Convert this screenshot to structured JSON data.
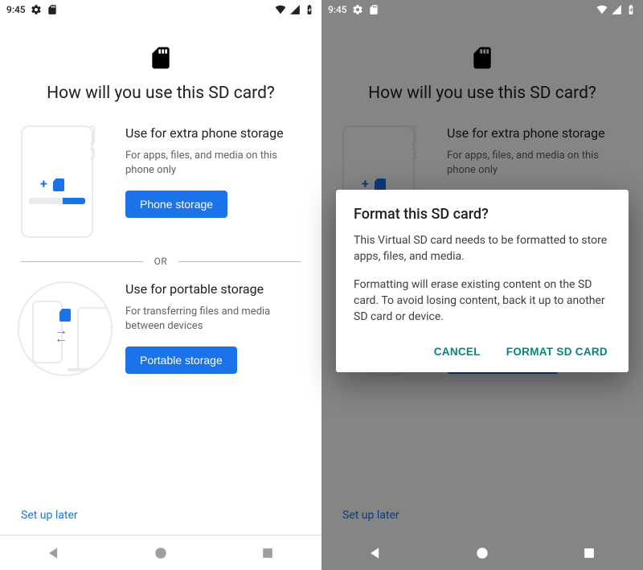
{
  "status": {
    "time": "9:45"
  },
  "page": {
    "title": "How will you use this SD card?",
    "option1": {
      "title": "Use for extra phone storage",
      "desc": "For apps, files, and media on this phone only",
      "button": "Phone storage"
    },
    "divider": "OR",
    "option2": {
      "title": "Use for portable storage",
      "desc": "For transferring files and media between devices",
      "button": "Portable storage"
    },
    "setup_later": "Set up later"
  },
  "dialog": {
    "title": "Format this SD card?",
    "body1": "This Virtual SD card needs to be formatted to store apps, files, and media.",
    "body2": "Formatting will erase existing content on the SD card. To avoid losing content, back it up to another SD card or device.",
    "cancel": "CANCEL",
    "confirm": "FORMAT SD CARD"
  },
  "colors": {
    "accent": "#1a73e8",
    "dialog_action": "#00897b"
  }
}
